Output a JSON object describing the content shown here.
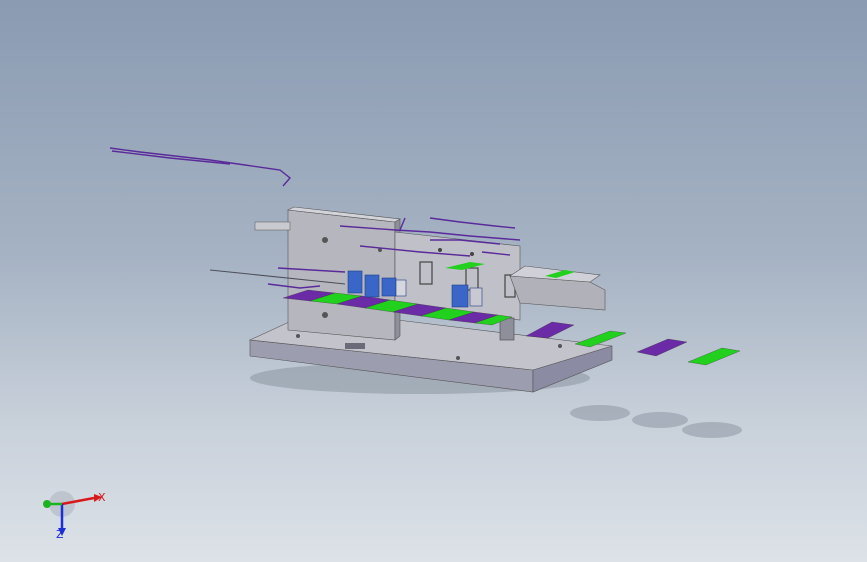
{
  "viewport": {
    "background_top": "#8a9bb2",
    "background_bottom": "#dde2e8"
  },
  "model": {
    "strip_colors": {
      "green": "#22d11d",
      "purple": "#6b2aa6"
    },
    "part_colors": {
      "sheet_metal": "#b9b9c1",
      "sheet_metal_dark": "#8d8d98",
      "base_side": "#a6a6bc",
      "clip_blue": "#3a66c7",
      "annotation_purple": "#5a2a9a"
    }
  },
  "triad": {
    "x_label": "X",
    "z_label": "Z",
    "x_color": "#d8191b",
    "y_color": "#1cb321",
    "z_color": "#1b2fd6"
  }
}
